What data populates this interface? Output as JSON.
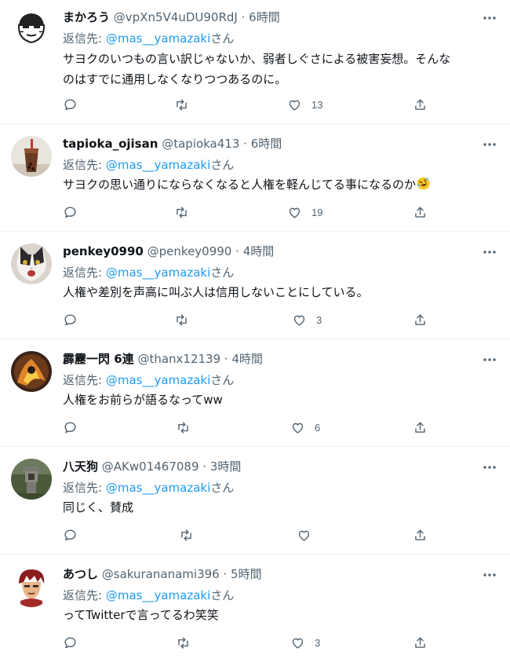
{
  "reply_prefix": "返信先: ",
  "dot": "·",
  "tweets": [
    {
      "name": "まかろう",
      "handle": "@vpXn5V4uDU90RdJ",
      "time": "6時間",
      "reply_to": "@mas__yamazaki",
      "reply_suffix": "さん",
      "lines": [
        "サヨクのいつもの言い訳じゃないか、弱者しぐさによる被害妄想。そんな",
        "のはすでに通用しなくなりつつあるのに。"
      ],
      "likes": "13"
    },
    {
      "name": "tapioka_ojisan",
      "handle": "@tapioka413",
      "time": "6時間",
      "reply_to": "@mas__yamazaki",
      "reply_suffix": "さん",
      "lines": [
        "サヨクの思い通りにならなくなると人権を軽んじてる事になるのか"
      ],
      "emoji": "rolling-on-floor-laughing",
      "likes": "19"
    },
    {
      "name": "penkey0990",
      "handle": "@penkey0990",
      "time": "4時間",
      "reply_to": "@mas__yamazaki",
      "reply_suffix": "さん",
      "lines": [
        "人権や差別を声高に叫ぶ人は信用しないことにしている。"
      ],
      "likes": "3"
    },
    {
      "name": "霹靂一閃 6連",
      "handle": "@thanx12139",
      "time": "4時間",
      "reply_to": "@mas__yamazaki",
      "reply_suffix": "さん",
      "lines": [
        "人権をお前らが語るなってww"
      ],
      "likes": "6"
    },
    {
      "name": "八天狗",
      "handle": "@AKw01467089",
      "time": "3時間",
      "reply_to": "@mas__yamazaki",
      "reply_suffix": "さん",
      "lines": [
        "同じく、賛成"
      ],
      "likes": ""
    },
    {
      "name": "あつし",
      "handle": "@sakurananami396",
      "time": "5時間",
      "reply_to": "@mas__yamazaki",
      "reply_suffix": "さん",
      "lines": [
        "ってTwitterで言ってるわ笑笑"
      ],
      "likes": "3"
    }
  ],
  "colors": {
    "text": "#0f1419",
    "secondary": "#536471",
    "link": "#1d9bf0",
    "divider": "#eff3f4"
  }
}
